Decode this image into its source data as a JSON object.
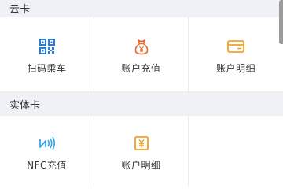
{
  "sections": [
    {
      "title": "云卡",
      "items": [
        {
          "label": "扫码乘车",
          "icon": "qr-code-icon",
          "color": "#2b7cd8"
        },
        {
          "label": "账户充值",
          "icon": "money-bag-icon",
          "color": "#e8672a"
        },
        {
          "label": "账户明细",
          "icon": "card-icon",
          "color": "#f2a124"
        }
      ]
    },
    {
      "title": "实体卡",
      "items": [
        {
          "label": "NFC充值",
          "icon": "nfc-icon",
          "color": "#35a3e8"
        },
        {
          "label": "账户明细",
          "icon": "receipt-icon",
          "color": "#f2a124"
        }
      ]
    }
  ],
  "colors": {
    "section_bg": "#f0f1f6",
    "divider": "#ececec",
    "text": "#333333"
  }
}
